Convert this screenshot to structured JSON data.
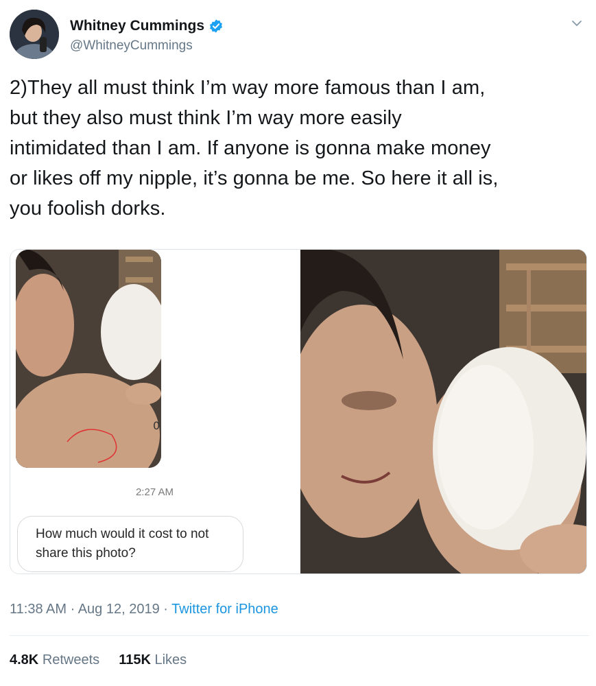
{
  "author": {
    "display_name": "Whitney Cummings",
    "handle": "@WhitneyCummings",
    "verified": true
  },
  "tweet": {
    "lines": [
      "2)They all must think I’m way more famous than I am,",
      "but they also must think I’m way more easily",
      "intimidated than I am. If anyone is gonna make money",
      "or likes off my nipple, it’s gonna be me. So here it all is,",
      "you foolish dorks."
    ]
  },
  "media": {
    "left": {
      "message_time": "2:27 AM",
      "message_lines": [
        "How much would it cost to not",
        "share this photo?"
      ]
    }
  },
  "meta": {
    "time": "11:38 AM",
    "separator": "·",
    "date": "Aug 12, 2019",
    "source": "Twitter for iPhone"
  },
  "stats": {
    "retweets_count": "4.8K",
    "retweets_label": "Retweets",
    "likes_count": "115K",
    "likes_label": "Likes"
  },
  "colors": {
    "link": "#1b95e0",
    "secondary_text": "#657786",
    "verified_badge": "#1da1f2"
  }
}
